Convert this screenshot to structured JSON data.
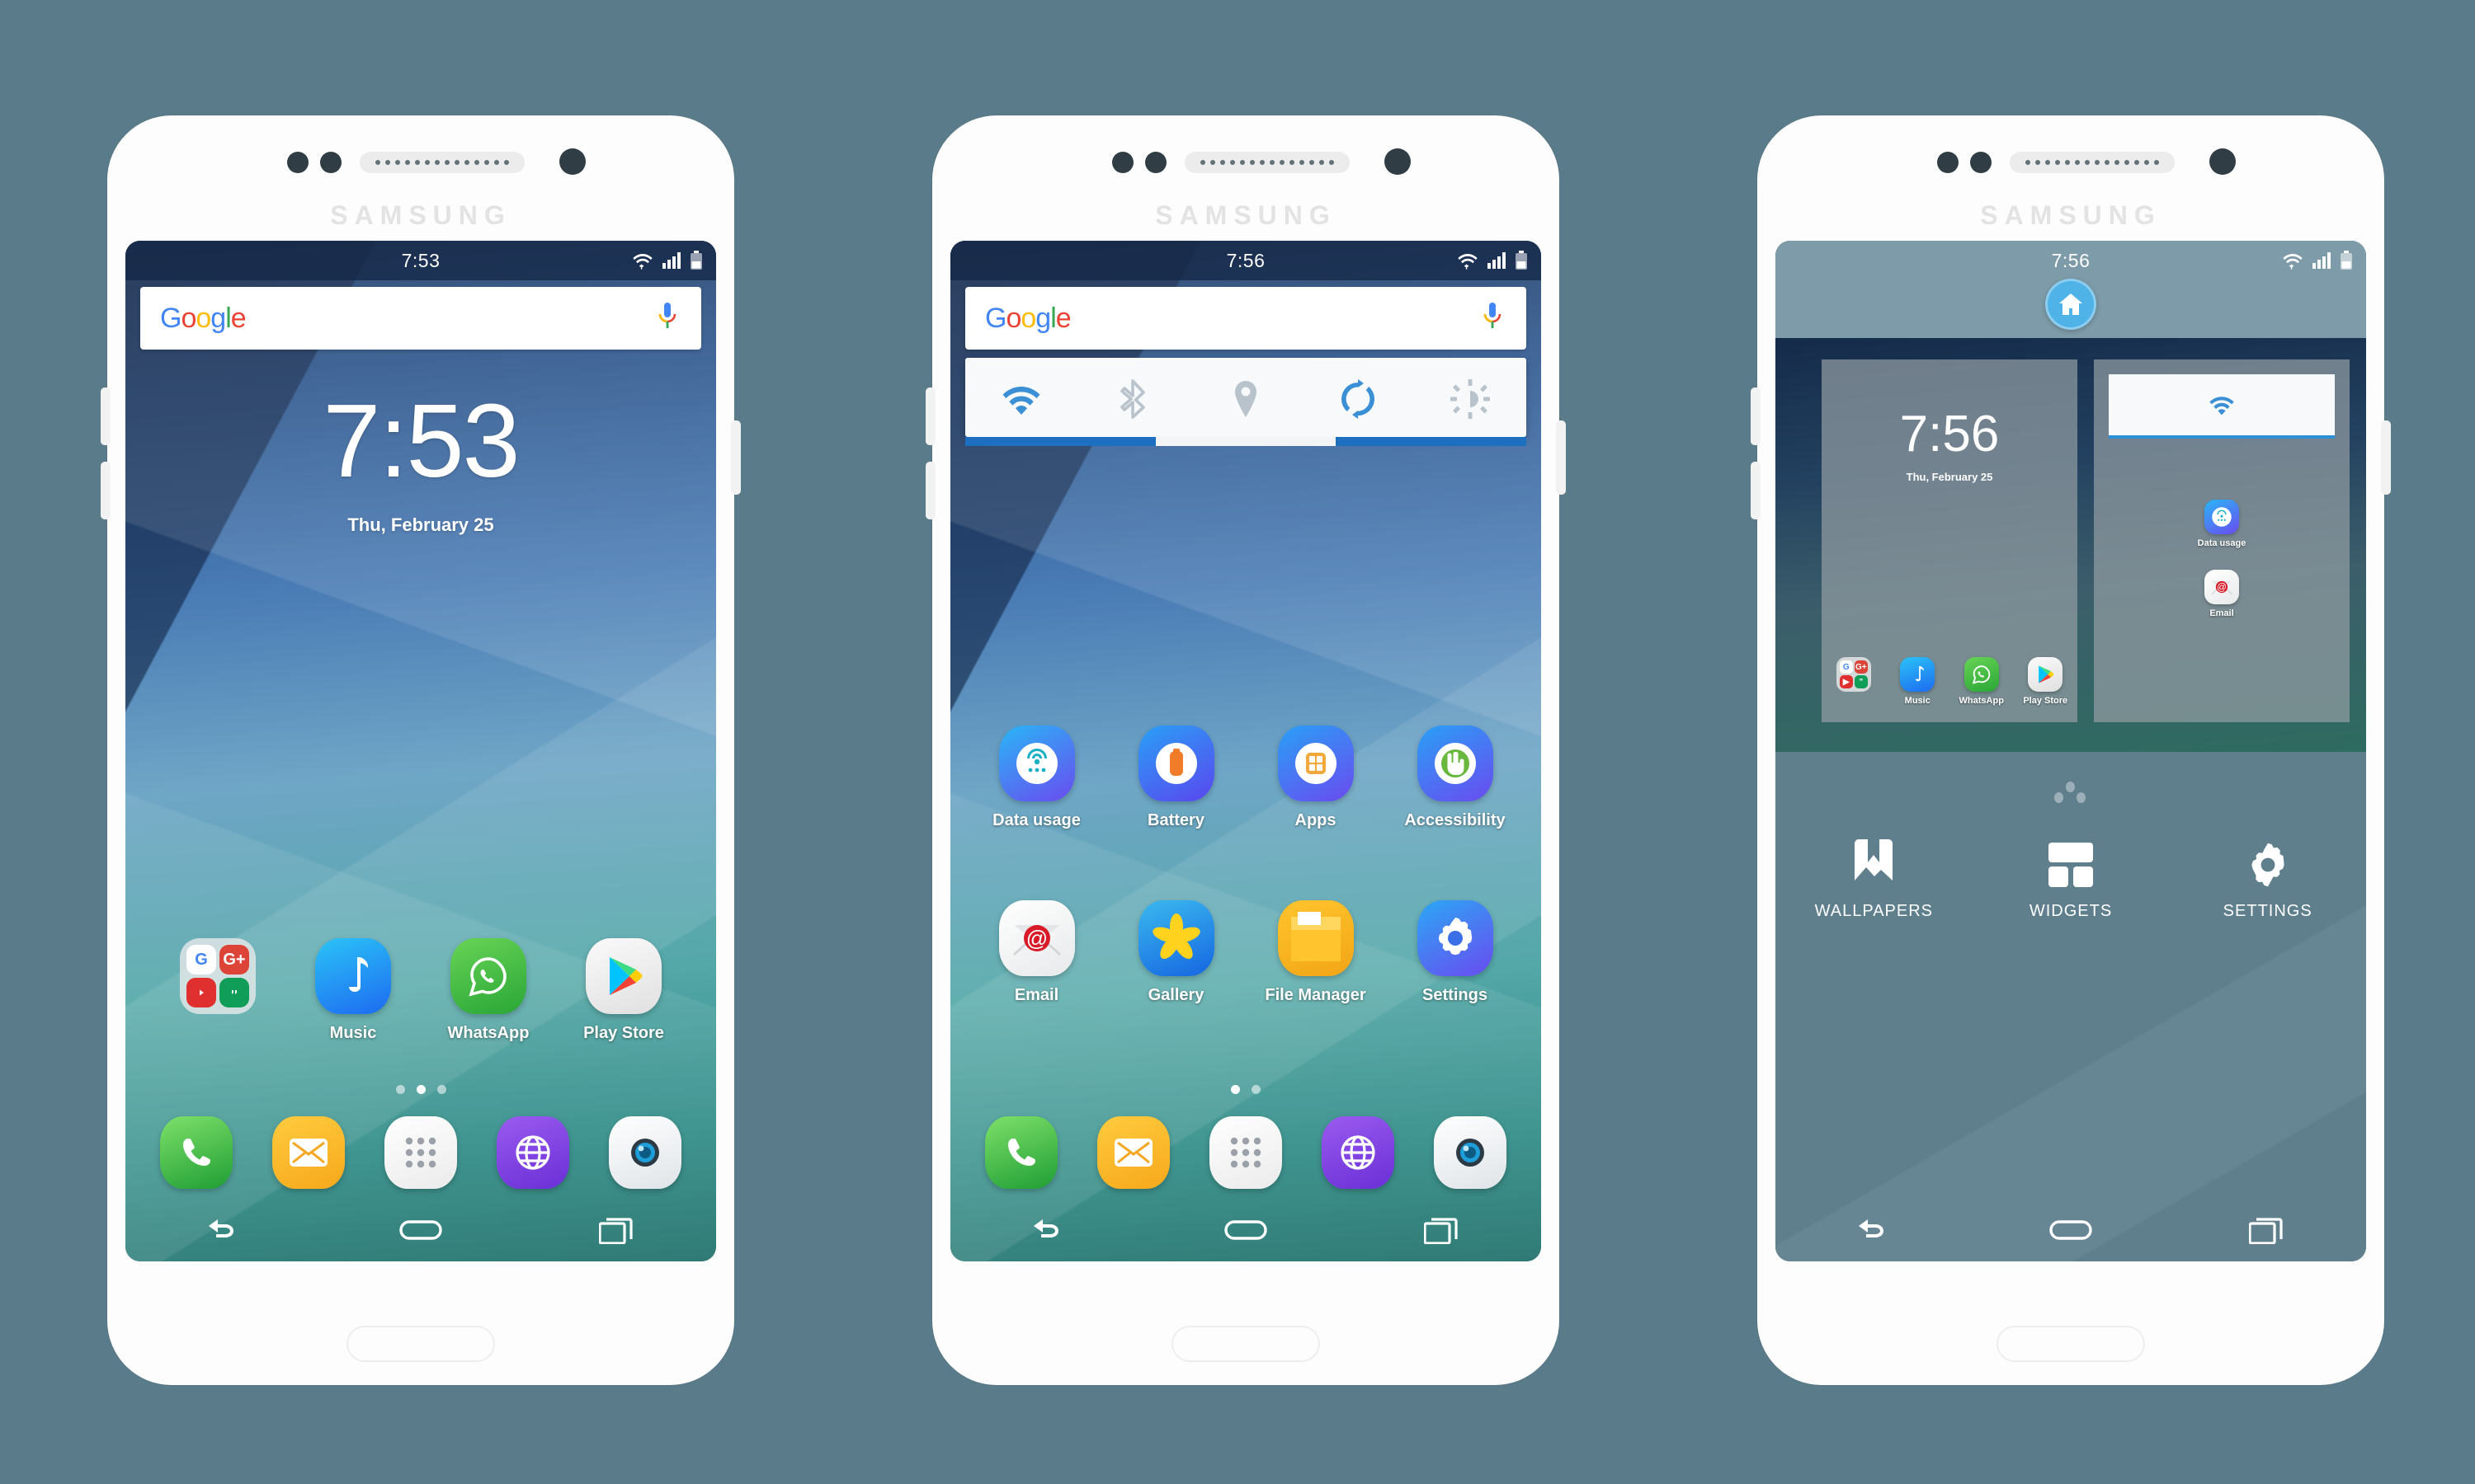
{
  "device": {
    "brand": "SAMSUNG"
  },
  "colors": {
    "accent_blue": "#2d8fd5",
    "status_bar": "#3b4e70",
    "editor_bg": "#5f7f8d",
    "page_bg": "#5a7b8a"
  },
  "phone1": {
    "name": "home-screen",
    "status": {
      "time": "7:53",
      "wifi": "wifi-icon",
      "signal": "signal-icon",
      "battery": "battery-icon"
    },
    "search": {
      "logo": "Google",
      "mic": "microphone-icon"
    },
    "clock": {
      "time": "7:53",
      "date": "Thu, February 25"
    },
    "apps": [
      {
        "label": "",
        "icon": "google-folder",
        "kind": "folder",
        "items": [
          {
            "name": "google-icon",
            "glyph": "G",
            "bg": "#ffffff",
            "fg": "#4285F4"
          },
          {
            "name": "google-plus-icon",
            "glyph": "G+",
            "bg": "#DB4437",
            "fg": "#ffffff"
          },
          {
            "name": "youtube-icon",
            "glyph": "▶",
            "bg": "#E02F2F",
            "fg": "#ffffff"
          },
          {
            "name": "hangouts-icon",
            "glyph": "”",
            "bg": "#0F9D58",
            "fg": "#ffffff"
          }
        ]
      },
      {
        "label": "Music",
        "icon": "music-icon",
        "kind": "app",
        "bg1": "#29b6f6",
        "bg2": "#1e6ef0",
        "glyph": "♪"
      },
      {
        "label": "WhatsApp",
        "icon": "whatsapp-icon",
        "kind": "app",
        "bg1": "#62d14d",
        "bg2": "#2aa637",
        "glyph": ""
      },
      {
        "label": "Play Store",
        "icon": "play-store-icon",
        "kind": "app",
        "bg1": "#f2f2f2",
        "bg2": "#e2e2e2",
        "glyph": ""
      }
    ],
    "page_dots": {
      "count": 3,
      "active": 1
    },
    "dock": [
      {
        "label": "Phone",
        "icon": "phone-icon"
      },
      {
        "label": "Messages",
        "icon": "messages-icon"
      },
      {
        "label": "Apps",
        "icon": "apps-grid-icon"
      },
      {
        "label": "Internet",
        "icon": "internet-icon"
      },
      {
        "label": "Camera",
        "icon": "camera-icon"
      }
    ],
    "nav": [
      {
        "label": "Back",
        "icon": "back-icon"
      },
      {
        "label": "Home",
        "icon": "home-pill-icon"
      },
      {
        "label": "Recents",
        "icon": "recents-icon"
      }
    ]
  },
  "phone2": {
    "name": "settings-shortcuts-screen",
    "status": {
      "time": "7:56"
    },
    "search": {
      "logo": "Google",
      "mic": "microphone-icon"
    },
    "quick_settings": [
      {
        "name": "wifi-toggle",
        "label": "Wi-Fi",
        "icon": "wifi-icon",
        "active": true
      },
      {
        "name": "bluetooth-toggle",
        "label": "Bluetooth",
        "icon": "bluetooth-icon",
        "active": false
      },
      {
        "name": "location-toggle",
        "label": "Location",
        "icon": "location-pin-icon",
        "active": false
      },
      {
        "name": "sync-toggle",
        "label": "Sync",
        "icon": "sync-icon",
        "active": true
      },
      {
        "name": "brightness-toggle",
        "label": "Brightness",
        "icon": "brightness-icon",
        "active": false
      }
    ],
    "apps_row1": [
      {
        "label": "Data usage",
        "icon": "data-usage-icon"
      },
      {
        "label": "Battery",
        "icon": "battery-app-icon"
      },
      {
        "label": "Apps",
        "icon": "apps-app-icon"
      },
      {
        "label": "Accessibility",
        "icon": "accessibility-icon"
      }
    ],
    "apps_row2": [
      {
        "label": "Email",
        "icon": "email-icon"
      },
      {
        "label": "Gallery",
        "icon": "gallery-icon"
      },
      {
        "label": "File Manager",
        "icon": "file-manager-icon"
      },
      {
        "label": "Settings",
        "icon": "settings-gear-icon"
      }
    ],
    "page_dots": {
      "count": 2,
      "active": 0
    },
    "dock": [
      {
        "label": "Phone",
        "icon": "phone-icon"
      },
      {
        "label": "Messages",
        "icon": "messages-icon"
      },
      {
        "label": "Apps",
        "icon": "apps-grid-icon"
      },
      {
        "label": "Internet",
        "icon": "internet-icon"
      },
      {
        "label": "Camera",
        "icon": "camera-icon"
      }
    ]
  },
  "phone3": {
    "name": "home-screen-editor",
    "status": {
      "time": "7:56"
    },
    "home_badge": {
      "icon": "home-icon",
      "label": "Default home screen"
    },
    "preview1": {
      "clock": {
        "time": "7:56",
        "date": "Thu, February 25"
      },
      "apps": [
        {
          "label": "",
          "icon": "google-folder",
          "kind": "folder"
        },
        {
          "label": "Music",
          "icon": "music-icon"
        },
        {
          "label": "WhatsApp",
          "icon": "whatsapp-icon"
        },
        {
          "label": "Play Store",
          "icon": "play-store-icon"
        }
      ]
    },
    "preview2": {
      "quick_setting": {
        "icon": "wifi-icon",
        "label": "Wi-Fi"
      },
      "apps": [
        {
          "label": "Data usage",
          "icon": "data-usage-icon"
        },
        {
          "label": "Email",
          "icon": "email-icon"
        }
      ]
    },
    "page_dots": {
      "count": 3,
      "active": -1
    },
    "actions": [
      {
        "label": "WALLPAPERS",
        "icon": "wallpaper-icon"
      },
      {
        "label": "WIDGETS",
        "icon": "widgets-icon"
      },
      {
        "label": "SETTINGS",
        "icon": "settings-gear-icon"
      }
    ]
  }
}
